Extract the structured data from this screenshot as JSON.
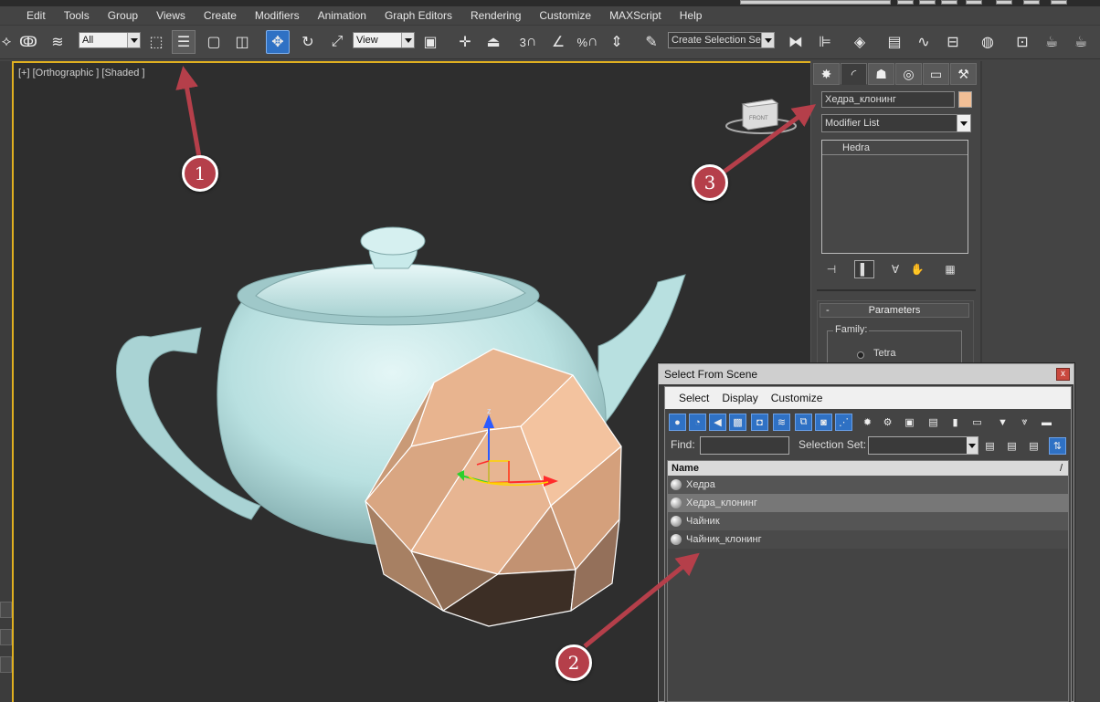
{
  "menubar": {
    "items": [
      "Edit",
      "Tools",
      "Group",
      "Views",
      "Create",
      "Modifiers",
      "Animation",
      "Graph Editors",
      "Rendering",
      "Customize",
      "MAXScript",
      "Help"
    ]
  },
  "toolbar": {
    "filter_value": "All",
    "refcoord_value": "View",
    "named_selection_placeholder": "Create Selection Se",
    "snap_label": "3",
    "percent_snap_label": "%",
    "icons": [
      "select-link",
      "unlink",
      "bind-space-warp",
      "select-object",
      "select-by-name",
      "rect-selection",
      "window-crossing",
      "select-move",
      "select-rotate",
      "select-scale",
      "pivot-center",
      "select-manipulate",
      "keyboard-shortcut",
      "snaps-toggle",
      "angle-snap",
      "percent-snap",
      "spinner-snap",
      "edit-named-selection",
      "mirror",
      "align",
      "layer-manager",
      "scene-explorer",
      "curve-editor",
      "schematic-view",
      "material-editor",
      "render-setup",
      "rendered-frame",
      "render-production"
    ]
  },
  "viewport": {
    "label": "[+] [Orthographic ] [Shaded ]",
    "viewcube_label": "FRONT",
    "gizmo_z": "z",
    "colors": {
      "teapot": "#b8e0e0",
      "hedra": "#e8b48f",
      "border": "#e0b020"
    }
  },
  "command_panel": {
    "tabs": [
      "create",
      "modify",
      "hierarchy",
      "motion",
      "display",
      "utilities"
    ],
    "object_name": "Хедра_клонинг",
    "object_color": "#f2bf96",
    "modifier_list": "Modifier List",
    "stack_items": [
      "Hedra"
    ],
    "parameters_title": "Parameters",
    "family_label": "Family:",
    "family_option": "Tetra"
  },
  "dialog": {
    "title": "Select From Scene",
    "close": "x",
    "menu": [
      "Select",
      "Display",
      "Customize"
    ],
    "find_label": "Find:",
    "find_value": "",
    "selection_set_label": "Selection Set:",
    "selection_set_value": "",
    "column_header": "Name",
    "sort_indicator": "/",
    "items": [
      "Хедра",
      "Хедра_клонинг",
      "Чайник",
      "Чайник_клонинг"
    ]
  },
  "annotations": {
    "badges": [
      "1",
      "2",
      "3"
    ],
    "color": "#b53f4a"
  }
}
